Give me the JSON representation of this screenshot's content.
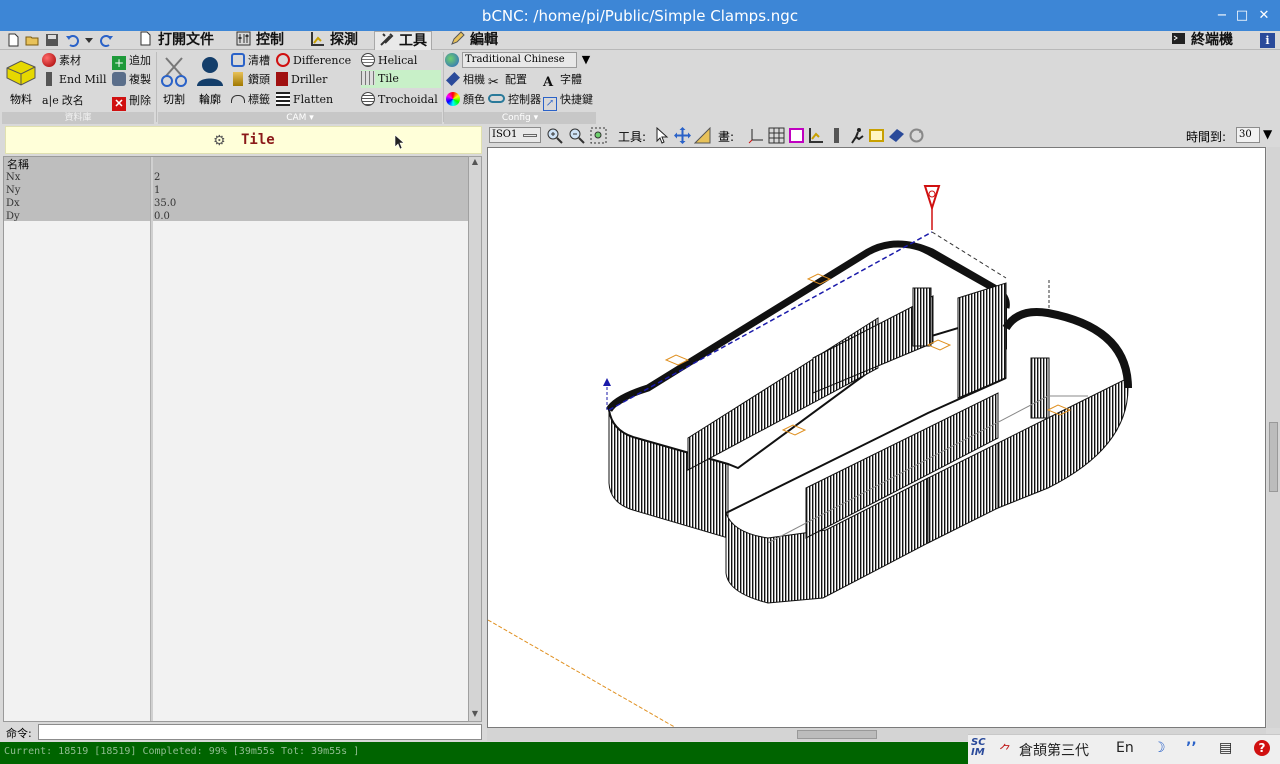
{
  "window": {
    "title": "bCNC: /home/pi/Public/Simple Clamps.ngc",
    "minimize": "−",
    "maximize": "□",
    "close": "✕"
  },
  "tabs": [
    {
      "label": "打開文件",
      "icon": "file-icon"
    },
    {
      "label": "控制",
      "icon": "control-icon"
    },
    {
      "label": "探測",
      "icon": "probe-icon"
    },
    {
      "label": "工具",
      "icon": "tools-icon",
      "active": true
    },
    {
      "label": "編輯",
      "icon": "edit-icon"
    }
  ],
  "terminal_tab": "終端機",
  "info_icon": "i",
  "ribbon": {
    "database": {
      "big_label": "物料",
      "stock": "素材",
      "end_mill": "End Mill",
      "rename": "改名",
      "add": "追加",
      "copy": "複製",
      "delete": "刪除",
      "group_label": "資料庫"
    },
    "cam": {
      "cut": "切割",
      "profile": "輪廓",
      "pocket": "清槽",
      "drill": "鑽頭",
      "tabs": "標籤",
      "difference": "Difference",
      "driller": "Driller",
      "flatten": "Flatten",
      "helical": "Helical",
      "tile": "Tile",
      "trochoidal": "Trochoidal",
      "group_label": "CAM"
    },
    "config": {
      "language": "Traditional Chinese",
      "camera": "相機",
      "layout": "配置",
      "font": "字體",
      "color": "顏色",
      "controller": "控制器",
      "shortcut": "快捷鍵",
      "group_label": "Config"
    }
  },
  "panel": {
    "header": "Tile",
    "column_name": "名稱",
    "rows": [
      {
        "name": "Nx",
        "value": "2"
      },
      {
        "name": "Ny",
        "value": "1"
      },
      {
        "name": "Dx",
        "value": "35.0"
      },
      {
        "name": "Dy",
        "value": "0.0"
      }
    ]
  },
  "command": {
    "label": "命令:",
    "value": ""
  },
  "status_text": "Current: 18519 [18519]  Completed: 99% [39m55s  Tot: 39m55s ]",
  "canvas_toolbar": {
    "view": "ISO1",
    "tools_label": "工具:",
    "draw_label": "畫:",
    "timeout_label": "時間到:",
    "timeout_value": "30"
  },
  "tray": {
    "ime": "倉頡第三代",
    "lang": "En"
  }
}
